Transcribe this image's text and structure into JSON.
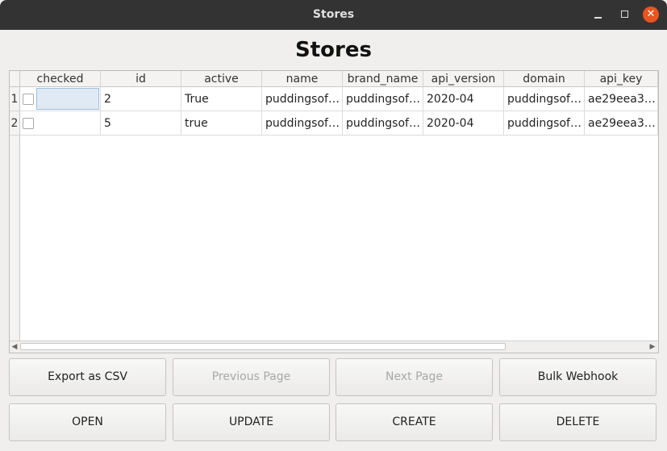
{
  "window": {
    "title": "Stores"
  },
  "page": {
    "heading": "Stores"
  },
  "table": {
    "columns": [
      "checked",
      "id",
      "active",
      "name",
      "brand_name",
      "api_version",
      "domain",
      "api_key"
    ],
    "rows": [
      {
        "row_num": "1",
        "checked": false,
        "id": "2",
        "active": "True",
        "name": "puddingsof…",
        "brand_name": "puddingsof…",
        "api_version": "2020-04",
        "domain": "puddingsof…",
        "api_key": "ae29eea3a…"
      },
      {
        "row_num": "2",
        "checked": false,
        "id": "5",
        "active": "true",
        "name": "puddingsof…",
        "brand_name": "puddingsof…",
        "api_version": "2020-04",
        "domain": "puddingsof…",
        "api_key": "ae29eea3a…"
      }
    ],
    "horizontal_scroll_position": 0.0
  },
  "buttons": {
    "export_csv": "Export as CSV",
    "previous_page": "Previous Page",
    "next_page": "Next Page",
    "bulk_webhook": "Bulk Webhook",
    "open": "OPEN",
    "update": "UPDATE",
    "create": "CREATE",
    "delete": "DELETE"
  },
  "icons": {
    "minimize": "minimize-icon",
    "maximize": "maximize-icon",
    "close": "close-icon",
    "scroll_left": "arrow-left-icon",
    "scroll_right": "arrow-right-icon"
  },
  "colors": {
    "titlebar": "#333333",
    "close_button": "#e95420",
    "selection": "#dfeaf4"
  }
}
